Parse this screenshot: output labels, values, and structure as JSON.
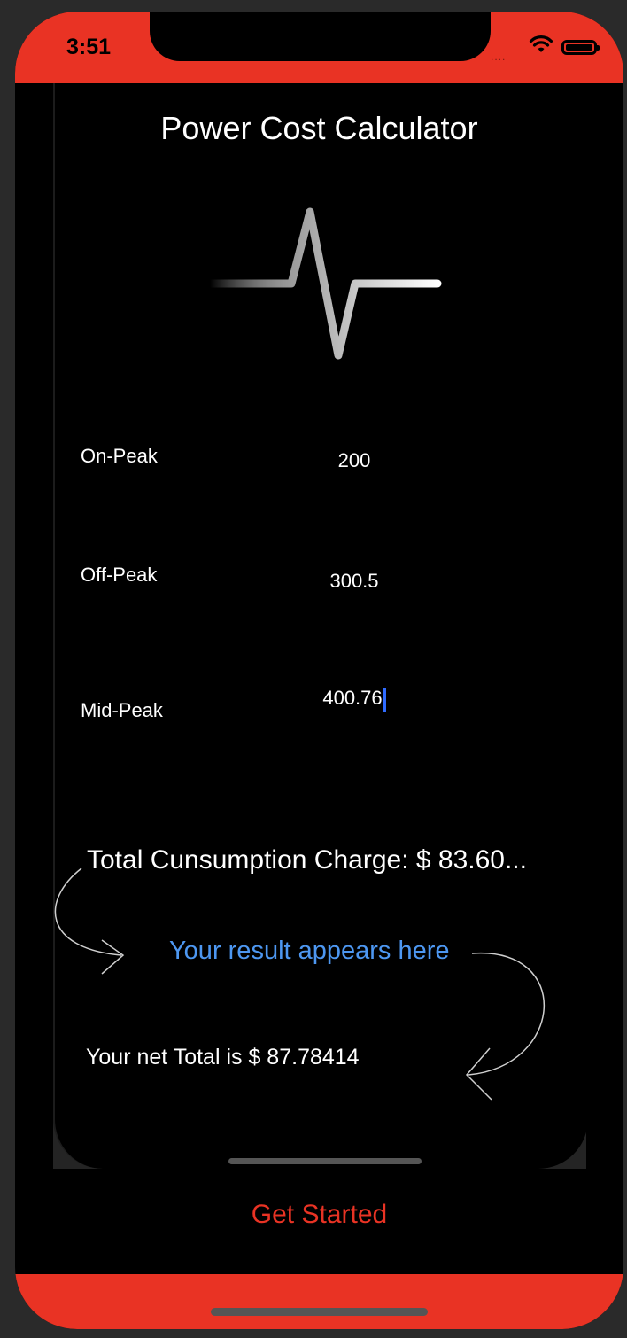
{
  "status_bar": {
    "time": "3:51",
    "signal": "....",
    "wifi_icon": "wifi-icon",
    "battery_icon": "battery-icon"
  },
  "app": {
    "title": "Power Cost Calculator",
    "logo_icon": "heartbeat-pulse-icon"
  },
  "inputs": [
    {
      "label": "On-Peak",
      "value": "200"
    },
    {
      "label": "Off-Peak",
      "value": "300.5"
    },
    {
      "label": "Mid-Peak",
      "value": "400.76"
    }
  ],
  "results": {
    "total_consumption": "Total Cunsumption Charge: $  83.60...",
    "hint": "Your result appears here",
    "net_total": "Your net Total is $ 87.78414"
  },
  "actions": {
    "get_started": "Get Started"
  },
  "colors": {
    "accent": "#e93324",
    "hint": "#4d97f1",
    "caret": "#2f6bff",
    "background": "#000000"
  }
}
